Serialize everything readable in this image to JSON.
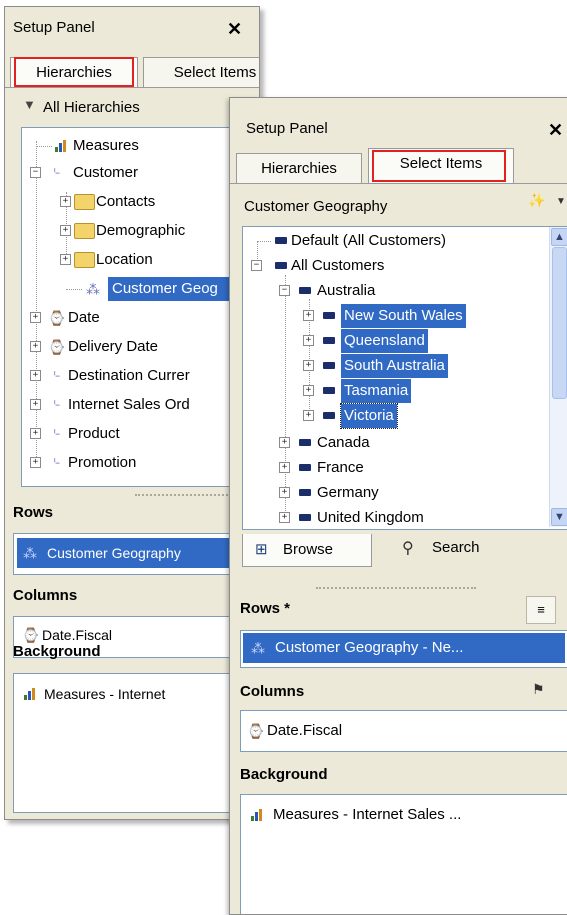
{
  "panel1": {
    "title": "Setup Panel",
    "close": "✕",
    "tabs": [
      "Hierarchies",
      "Select Items"
    ],
    "filter_label": "All Hierarchies",
    "tree": [
      {
        "label": "Measures"
      },
      {
        "label": "Customer"
      },
      {
        "label": "Contacts"
      },
      {
        "label": "Demographic"
      },
      {
        "label": "Location"
      },
      {
        "label": "Customer Geog"
      },
      {
        "label": "Date"
      },
      {
        "label": "Delivery Date"
      },
      {
        "label": "Destination Currer"
      },
      {
        "label": "Internet Sales Ord"
      },
      {
        "label": "Product"
      },
      {
        "label": "Promotion"
      }
    ],
    "rows_header": "Rows",
    "rows_item": "Customer Geography",
    "columns_header": "Columns",
    "columns_item": "Date.Fiscal",
    "background_header": "Background",
    "background_item": "Measures - Internet"
  },
  "panel2": {
    "title": "Setup Panel",
    "close": "✕",
    "tabs": [
      "Hierarchies",
      "Select Items"
    ],
    "hierarchy_label": "Customer Geography",
    "tree": [
      {
        "label": "Default (All Customers)"
      },
      {
        "label": "All Customers"
      },
      {
        "label": "Australia"
      },
      {
        "label": "New South Wales"
      },
      {
        "label": "Queensland"
      },
      {
        "label": "South Australia"
      },
      {
        "label": "Tasmania"
      },
      {
        "label": "Victoria"
      },
      {
        "label": "Canada"
      },
      {
        "label": "France"
      },
      {
        "label": "Germany"
      },
      {
        "label": "United Kingdom"
      }
    ],
    "browse_tab": "Browse",
    "search_tab": "Search",
    "rows_header": "Rows *",
    "rows_item": "Customer Geography - Ne...",
    "columns_header": "Columns",
    "columns_item": "Date.Fiscal",
    "background_header": "Background",
    "background_item": "Measures - Internet Sales ..."
  },
  "colors": {
    "panel_bg": "#ece9d8",
    "selection": "#316ac5",
    "highlight_box": "#e32121"
  }
}
